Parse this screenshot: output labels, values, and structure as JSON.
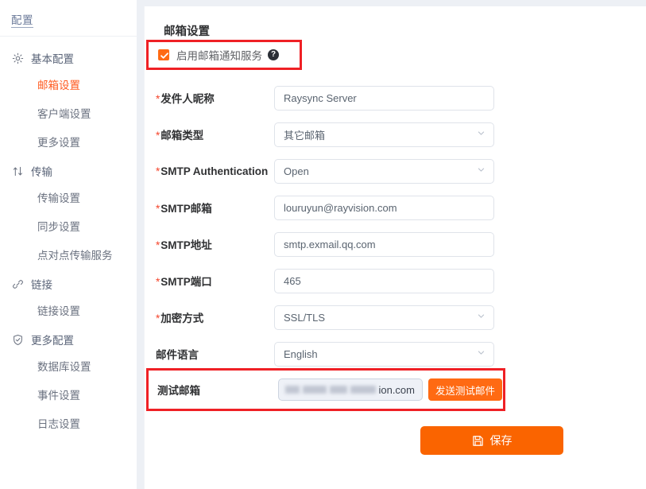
{
  "sidebar": {
    "brand": "配置",
    "groups": [
      {
        "icon": "gear-icon",
        "label": "基本配置",
        "items": [
          {
            "label": "邮箱设置",
            "active": true
          },
          {
            "label": "客户端设置",
            "active": false
          },
          {
            "label": "更多设置",
            "active": false
          }
        ]
      },
      {
        "icon": "transfer-arrows-icon",
        "label": "传输",
        "items": [
          {
            "label": "传输设置",
            "active": false
          },
          {
            "label": "同步设置",
            "active": false
          },
          {
            "label": "点对点传输服务",
            "active": false
          }
        ]
      },
      {
        "icon": "link-icon",
        "label": "链接",
        "items": [
          {
            "label": "链接设置",
            "active": false
          }
        ]
      },
      {
        "icon": "shield-check-icon",
        "label": "更多配置",
        "items": [
          {
            "label": "数据库设置",
            "active": false
          },
          {
            "label": "事件设置",
            "active": false
          },
          {
            "label": "日志设置",
            "active": false
          }
        ]
      }
    ]
  },
  "main": {
    "title": "邮箱设置",
    "enable": {
      "checked": true,
      "label": "启用邮箱通知服务",
      "help_glyph": "?"
    },
    "fields": [
      {
        "required": true,
        "label": "发件人昵称",
        "value": "Raysync Server",
        "type": "text"
      },
      {
        "required": true,
        "label": "邮箱类型",
        "value": "其它邮箱",
        "type": "select"
      },
      {
        "required": true,
        "label": "SMTP Authentication",
        "value": "Open",
        "type": "select"
      },
      {
        "required": true,
        "label": "SMTP邮箱",
        "value": "louruyun@rayvision.com",
        "type": "text"
      },
      {
        "required": true,
        "label": "SMTP地址",
        "value": "smtp.exmail.qq.com",
        "type": "text"
      },
      {
        "required": true,
        "label": "SMTP端口",
        "value": "465",
        "type": "text"
      },
      {
        "required": true,
        "label": "加密方式",
        "value": "SSL/TLS",
        "type": "select"
      },
      {
        "required": false,
        "label": "邮件语言",
        "value": "English",
        "type": "select"
      }
    ],
    "test_mail": {
      "label": "测试邮箱",
      "value": "ion.com",
      "redacted": true,
      "button_label": "发送测试邮件"
    },
    "save": {
      "label": "保存",
      "icon": "save-disk-icon"
    }
  },
  "colors": {
    "accent_orange": "#fa6400",
    "button_orange": "#ff6a13",
    "highlight_red": "#ef2025",
    "required_red": "#f5452c",
    "active_nav": "#ff5a1f"
  }
}
